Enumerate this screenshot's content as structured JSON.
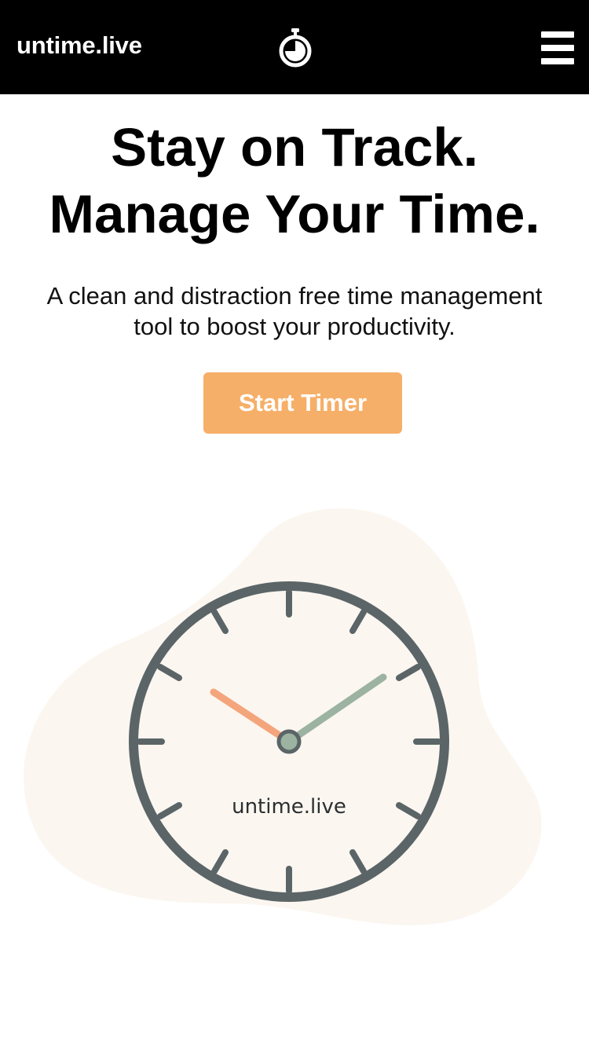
{
  "header": {
    "brand": "untime.live",
    "logo_icon": "stopwatch-icon",
    "menu_icon": "hamburger-menu-icon"
  },
  "hero": {
    "title_line1": "Stay on Track.",
    "title_line2": "Manage Your Time.",
    "subtitle_line1": "A clean and distraction free time management",
    "subtitle_line2": "tool to boost your productivity.",
    "cta_label": "Start Timer"
  },
  "illustration": {
    "clock_label": "untime.live",
    "icon": "clock-icon"
  },
  "colors": {
    "header_bg": "#000000",
    "accent": "#f6af68",
    "blob": "#fbf6f0",
    "clock_stroke": "#5b6567",
    "hour_hand": "#f4a57c",
    "minute_hand": "#9bb3a0"
  }
}
